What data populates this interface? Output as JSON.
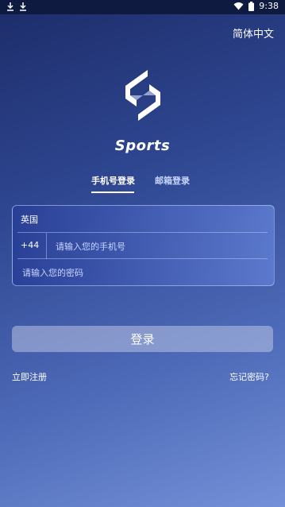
{
  "status_bar": {
    "time": "9:38"
  },
  "language_switch": "简体中文",
  "brand": "Sports",
  "tabs": [
    {
      "label": "手机号登录",
      "active": true
    },
    {
      "label": "邮箱登录",
      "active": false
    }
  ],
  "form": {
    "country": "英国",
    "country_code": "+44",
    "phone_placeholder": "请输入您的手机号",
    "password_placeholder": "请输入您的密码"
  },
  "login_button": "登录",
  "register_link": "立即注册",
  "forgot_link": "忘记密码?"
}
